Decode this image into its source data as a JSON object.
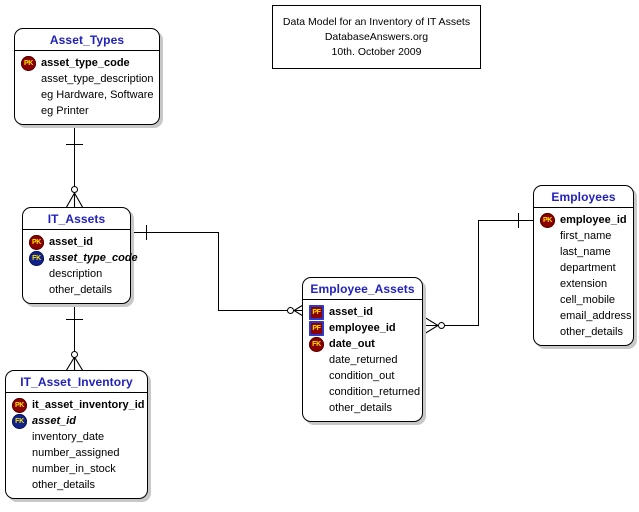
{
  "diagram": {
    "title_box": {
      "line1": "Data Model for an Inventory of IT Assets",
      "line2": "DatabaseAnswers.org",
      "line3": "10th. October 2009"
    },
    "colors": {
      "entity_title": "#2222bb",
      "pk_icon": "#8b0000",
      "fk_icon": "#11228c",
      "pf_icon_border": "#2b3acc",
      "icon_text": "#ffe400",
      "line": "#000000",
      "shadow": "#c8c8c8",
      "background": "#ffffff"
    },
    "entities": [
      {
        "name": "Asset_Types",
        "attributes": [
          {
            "name": "asset_type_code",
            "key": "PK",
            "icon": "pk-key-icon"
          },
          {
            "name": "asset_type_description",
            "key": "",
            "icon": ""
          },
          {
            "name": "eg Hardware, Software",
            "key": "",
            "icon": ""
          },
          {
            "name": "eg Printer",
            "key": "",
            "icon": ""
          }
        ]
      },
      {
        "name": "IT_Assets",
        "attributes": [
          {
            "name": "asset_id",
            "key": "PK",
            "icon": "pk-key-icon"
          },
          {
            "name": "asset_type_code",
            "key": "FK",
            "icon": "fk-key-icon"
          },
          {
            "name": "description",
            "key": "",
            "icon": ""
          },
          {
            "name": "other_details",
            "key": "",
            "icon": ""
          }
        ]
      },
      {
        "name": "IT_Asset_Inventory",
        "attributes": [
          {
            "name": "it_asset_inventory_id",
            "key": "PK",
            "icon": "pk-key-icon"
          },
          {
            "name": "asset_id",
            "key": "FK",
            "icon": "fk-key-icon"
          },
          {
            "name": "inventory_date",
            "key": "",
            "icon": ""
          },
          {
            "name": "number_assigned",
            "key": "",
            "icon": ""
          },
          {
            "name": "number_in_stock",
            "key": "",
            "icon": ""
          },
          {
            "name": "other_details",
            "key": "",
            "icon": ""
          }
        ]
      },
      {
        "name": "Employee_Assets",
        "attributes": [
          {
            "name": "asset_id",
            "key": "PF",
            "icon": "pf-key-icon"
          },
          {
            "name": "employee_id",
            "key": "PF",
            "icon": "pf-key-icon"
          },
          {
            "name": "date_out",
            "key": "FK",
            "icon": "pk-key-icon"
          },
          {
            "name": "date_returned",
            "key": "",
            "icon": ""
          },
          {
            "name": "condition_out",
            "key": "",
            "icon": ""
          },
          {
            "name": "condition_returned",
            "key": "",
            "icon": ""
          },
          {
            "name": "other_details",
            "key": "",
            "icon": ""
          }
        ]
      },
      {
        "name": "Employees",
        "attributes": [
          {
            "name": "employee_id",
            "key": "PK",
            "icon": "pk-key-icon"
          },
          {
            "name": "first_name",
            "key": "",
            "icon": ""
          },
          {
            "name": "last_name",
            "key": "",
            "icon": ""
          },
          {
            "name": "department",
            "key": "",
            "icon": ""
          },
          {
            "name": "extension",
            "key": "",
            "icon": ""
          },
          {
            "name": "cell_mobile",
            "key": "",
            "icon": ""
          },
          {
            "name": "email_address",
            "key": "",
            "icon": ""
          },
          {
            "name": "other_details",
            "key": "",
            "icon": ""
          }
        ]
      }
    ],
    "relationships": [
      {
        "from": "Asset_Types",
        "to": "IT_Assets",
        "from_card": "one",
        "to_card": "zero-or-many"
      },
      {
        "from": "IT_Assets",
        "to": "IT_Asset_Inventory",
        "from_card": "one",
        "to_card": "zero-or-many"
      },
      {
        "from": "IT_Assets",
        "to": "Employee_Assets",
        "from_card": "one",
        "to_card": "zero-or-many"
      },
      {
        "from": "Employees",
        "to": "Employee_Assets",
        "from_card": "one",
        "to_card": "zero-or-many"
      }
    ]
  }
}
